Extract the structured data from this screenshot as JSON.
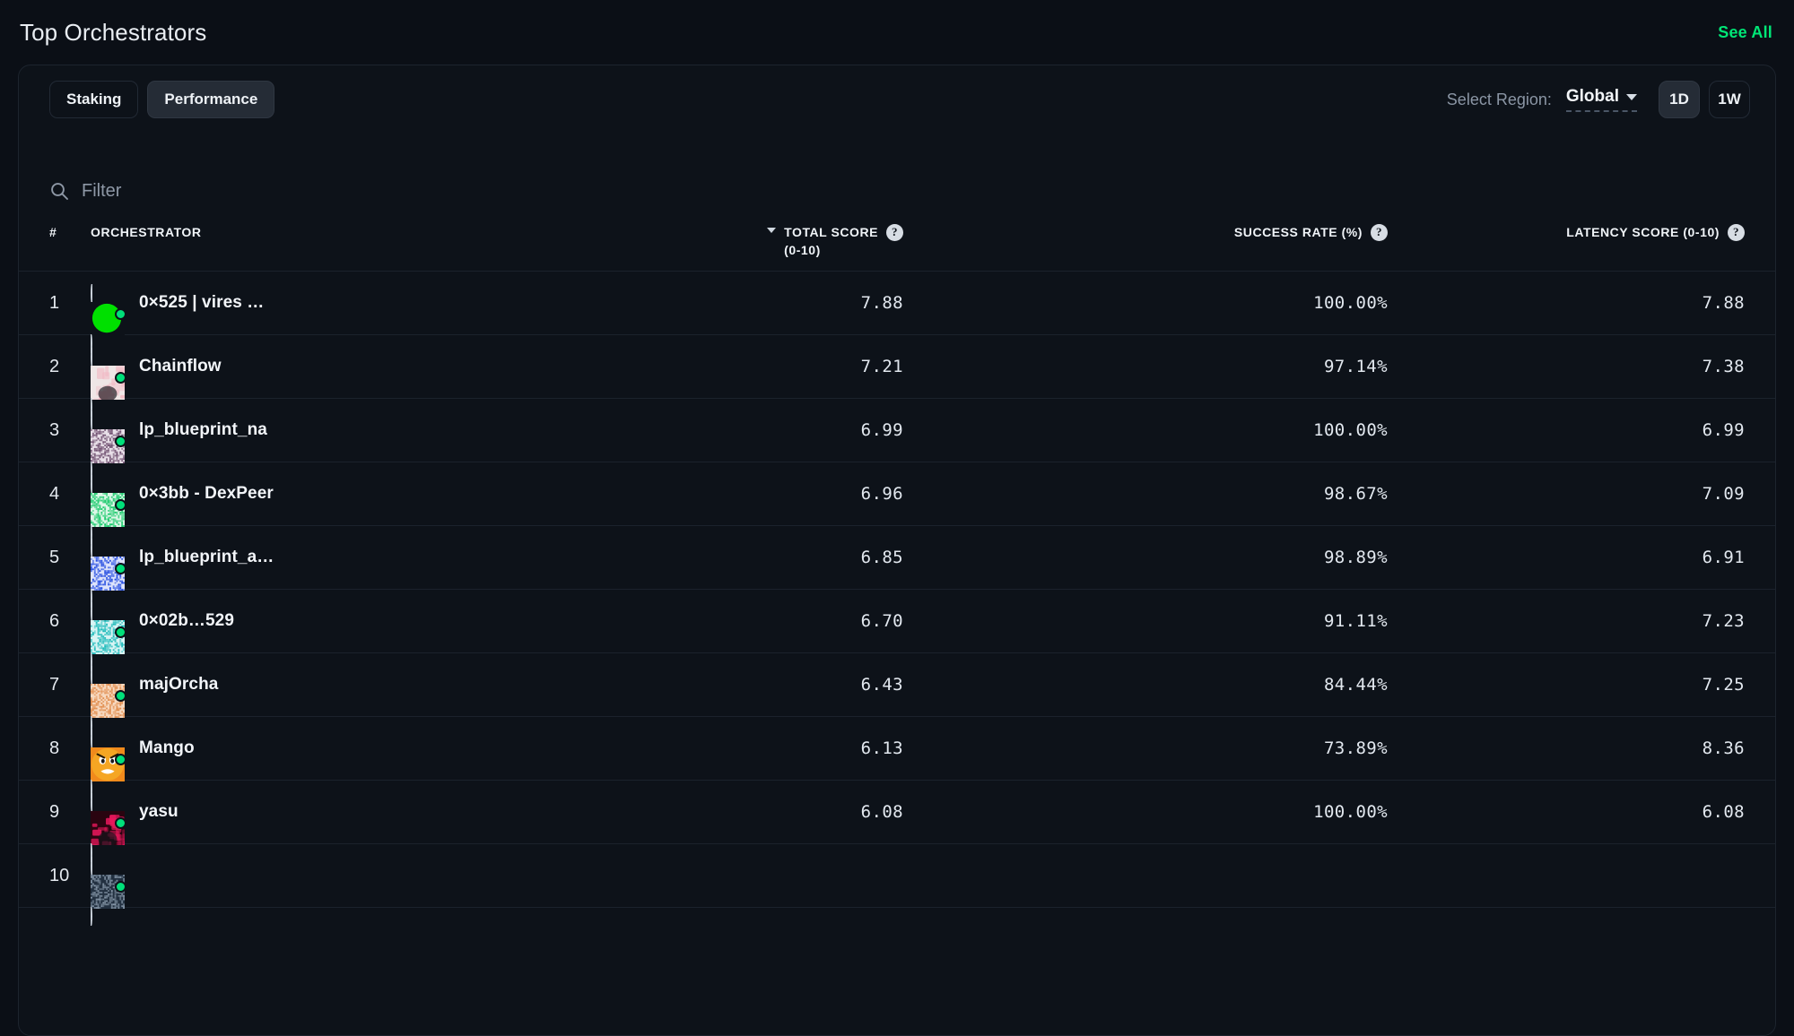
{
  "header": {
    "title": "Top Orchestrators",
    "see_all_label": "See All",
    "accent_color": "#00e676"
  },
  "toolbar": {
    "tabs": [
      {
        "label": "Staking",
        "active": false
      },
      {
        "label": "Performance",
        "active": true
      }
    ],
    "region_label": "Select Region:",
    "region_value": "Global",
    "ranges": [
      {
        "label": "1D",
        "active": true
      },
      {
        "label": "1W",
        "active": false
      }
    ]
  },
  "filter": {
    "placeholder": "Filter",
    "value": ""
  },
  "table": {
    "columns": [
      {
        "key": "rank",
        "label": "#",
        "help": false,
        "sorted": false
      },
      {
        "key": "orchestrator",
        "label": "Orchestrator",
        "help": false,
        "sorted": false
      },
      {
        "key": "total_score",
        "label": "Total Score",
        "sub": "(0-10)",
        "help": true,
        "sorted": true,
        "sort_dir": "desc"
      },
      {
        "key": "success_rate",
        "label": "Success Rate (%)",
        "help": true,
        "sorted": false
      },
      {
        "key": "latency_score",
        "label": "Latency Score (0-10)",
        "help": true,
        "sorted": false
      }
    ],
    "help_glyph": "?",
    "rows": [
      {
        "rank": "1",
        "name": "0×525 | vires …",
        "total_score": "7.88",
        "success_rate": "100.00%",
        "latency_score": "7.88",
        "online": true,
        "avatar": {
          "style": "blob",
          "color": "#00e000",
          "bg": "#0d1219"
        }
      },
      {
        "rank": "2",
        "name": "Chainflow",
        "total_score": "7.21",
        "success_rate": "97.14%",
        "latency_score": "7.38",
        "online": true,
        "avatar": {
          "style": "photo",
          "color": "#f2b9c4",
          "bg": "#efe6e6"
        }
      },
      {
        "rank": "3",
        "name": "lp_blueprint_na",
        "total_score": "6.99",
        "success_rate": "100.00%",
        "latency_score": "6.99",
        "online": true,
        "avatar": {
          "style": "noise",
          "color": "#6b4a6b",
          "bg": "#e8dfe8"
        }
      },
      {
        "rank": "4",
        "name": "0×3bb - DexPeer",
        "total_score": "6.96",
        "success_rate": "98.67%",
        "latency_score": "7.09",
        "online": true,
        "avatar": {
          "style": "noise",
          "color": "#18c96a",
          "bg": "#dff7e9"
        }
      },
      {
        "rank": "5",
        "name": "lp_blueprint_a…",
        "total_score": "6.85",
        "success_rate": "98.89%",
        "latency_score": "6.91",
        "online": true,
        "avatar": {
          "style": "noise",
          "color": "#1f48e0",
          "bg": "#dde3fb"
        }
      },
      {
        "rank": "6",
        "name": "0×02b…529",
        "total_score": "6.70",
        "success_rate": "91.11%",
        "latency_score": "7.23",
        "online": true,
        "avatar": {
          "style": "noise",
          "color": "#17b8b8",
          "bg": "#d9f4f4"
        }
      },
      {
        "rank": "7",
        "name": "majOrcha",
        "total_score": "6.43",
        "success_rate": "84.44%",
        "latency_score": "7.25",
        "online": true,
        "avatar": {
          "style": "noise",
          "color": "#e08a4a",
          "bg": "#f7d9c0"
        }
      },
      {
        "rank": "8",
        "name": "Mango",
        "total_score": "6.13",
        "success_rate": "73.89%",
        "latency_score": "8.36",
        "online": true,
        "avatar": {
          "style": "face",
          "color": "#f5a623",
          "bg": "#f08a1c"
        }
      },
      {
        "rank": "9",
        "name": "yasu",
        "total_score": "6.08",
        "success_rate": "100.00%",
        "latency_score": "6.08",
        "online": true,
        "avatar": {
          "style": "photo",
          "color": "#e8185c",
          "bg": "#2a0410"
        }
      },
      {
        "rank": "10",
        "name": "",
        "total_score": "",
        "success_rate": "",
        "latency_score": "",
        "online": true,
        "avatar": {
          "style": "noise",
          "color": "#8899aa",
          "bg": "#223040"
        }
      }
    ]
  }
}
